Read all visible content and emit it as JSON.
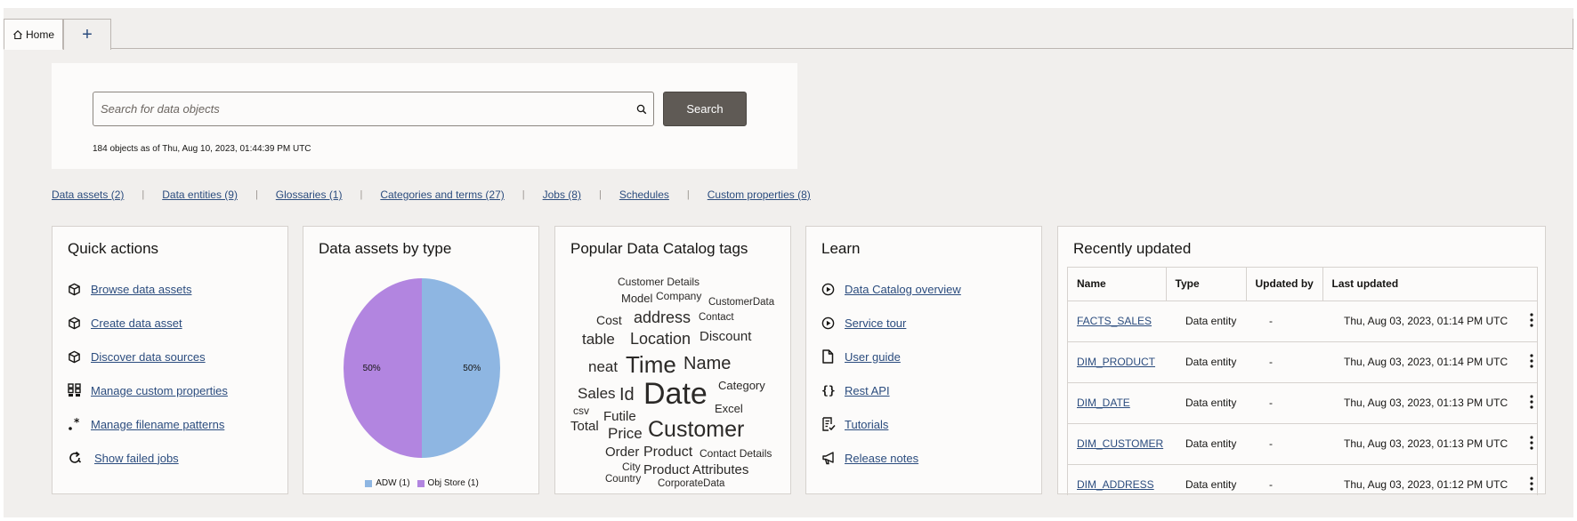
{
  "tabs": {
    "home_label": "Home",
    "add_label": "+"
  },
  "search": {
    "placeholder": "Search for data objects",
    "button_label": "Search",
    "count_text": "184 objects as of Thu, Aug 10, 2023, 01:44:39 PM UTC"
  },
  "links": [
    "Data assets (2)",
    "Data entities (9)",
    "Glossaries (1)",
    "Categories and terms (27)",
    "Jobs (8)",
    "Schedules",
    "Custom properties (8)"
  ],
  "quick_actions": {
    "title": "Quick actions",
    "items": [
      {
        "label": "Browse data assets",
        "icon": "cube-icon"
      },
      {
        "label": "Create data asset",
        "icon": "cube-icon"
      },
      {
        "label": "Discover data sources",
        "icon": "cube-icon"
      },
      {
        "label": "Manage custom properties",
        "icon": "grid-icon"
      },
      {
        "label": "Manage filename patterns",
        "icon": "wildcard-icon"
      },
      {
        "label": "Show failed jobs",
        "icon": "refresh-icon"
      }
    ]
  },
  "assets_by_type": {
    "title": "Data assets by type"
  },
  "chart_data": {
    "type": "pie",
    "categories": [
      "ADW (1)",
      "Obj Store (1)"
    ],
    "values": [
      50,
      50
    ],
    "data_labels": [
      "50%",
      "50%"
    ],
    "colors": [
      "#8eb6e2",
      "#b285e0"
    ],
    "legend": "bottom"
  },
  "tags": {
    "title": "Popular Data Catalog tags",
    "words": [
      "Customer Details",
      "Model",
      "Company",
      "CustomerData",
      "Cost",
      "address",
      "Contact",
      "table",
      "Location",
      "Discount",
      "neat",
      "Time",
      "Name",
      "Category",
      "Sales",
      "Id",
      "Date",
      "Excel",
      "csv",
      "Futile",
      "Total",
      "Price",
      "Customer",
      "Order",
      "Product",
      "Contact Details",
      "City",
      "Product Attributes",
      "Country",
      "CorporateData"
    ]
  },
  "learn": {
    "title": "Learn",
    "items": [
      {
        "label": "Data Catalog overview",
        "icon": "play-circle-icon"
      },
      {
        "label": "Service tour",
        "icon": "play-circle-icon"
      },
      {
        "label": "User guide",
        "icon": "document-icon"
      },
      {
        "label": "Rest API",
        "icon": "braces-icon"
      },
      {
        "label": "Tutorials",
        "icon": "checklist-icon"
      },
      {
        "label": "Release notes",
        "icon": "megaphone-icon"
      }
    ]
  },
  "recent": {
    "title": "Recently updated",
    "columns": [
      "Name",
      "Type",
      "Updated by",
      "Last updated"
    ],
    "rows": [
      {
        "name": "FACTS_SALES",
        "type": "Data entity",
        "by": "-",
        "when": "Thu, Aug 03, 2023, 01:14 PM UTC"
      },
      {
        "name": "DIM_PRODUCT",
        "type": "Data entity",
        "by": "-",
        "when": "Thu, Aug 03, 2023, 01:14 PM UTC"
      },
      {
        "name": "DIM_DATE",
        "type": "Data entity",
        "by": "-",
        "when": "Thu, Aug 03, 2023, 01:13 PM UTC"
      },
      {
        "name": "DIM_CUSTOMER",
        "type": "Data entity",
        "by": "-",
        "when": "Thu, Aug 03, 2023, 01:13 PM UTC"
      },
      {
        "name": "DIM_ADDRESS",
        "type": "Data entity",
        "by": "-",
        "when": "Thu, Aug 03, 2023, 01:12 PM UTC"
      }
    ]
  }
}
